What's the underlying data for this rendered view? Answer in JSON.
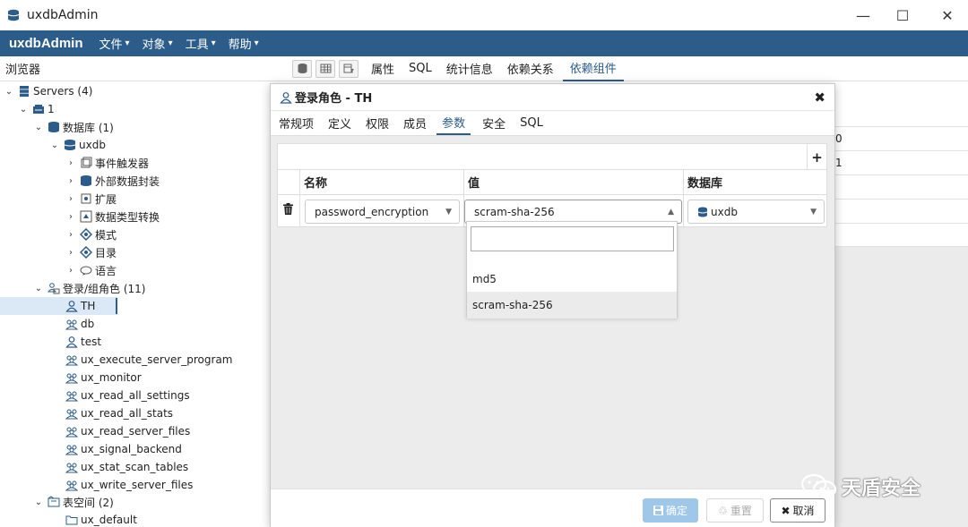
{
  "window": {
    "title": "uxdbAdmin",
    "minimize": "—",
    "maximize": "☐",
    "close": "✕"
  },
  "menubar": {
    "brand": "uxdbAdmin",
    "items": [
      {
        "label": "文件"
      },
      {
        "label": "对象"
      },
      {
        "label": "工具"
      },
      {
        "label": "帮助"
      }
    ]
  },
  "browser": {
    "title": "浏览器"
  },
  "panel_tabs": [
    {
      "label": "属性"
    },
    {
      "label": "SQL"
    },
    {
      "label": "统计信息"
    },
    {
      "label": "依赖关系"
    },
    {
      "label": "依赖组件"
    }
  ],
  "tree": {
    "servers": "Servers (4)",
    "server1": "1",
    "databases": "数据库 (1)",
    "uxdb": "uxdb",
    "event_triggers": "事件触发器",
    "fdw": "外部数据封装",
    "extensions": "扩展",
    "casts": "数据类型转换",
    "schemas": "模式",
    "catalogs": "目录",
    "languages": "语言",
    "roles": "登录/组角色 (11)",
    "role_items": [
      "TH",
      "db",
      "test",
      "ux_execute_server_program",
      "ux_monitor",
      "ux_read_all_settings",
      "ux_read_all_stats",
      "ux_read_server_files",
      "ux_signal_backend",
      "ux_stat_scan_tables",
      "ux_write_server_files"
    ],
    "tablespaces": "表空间 (2)",
    "ux_default": "ux_default"
  },
  "right_panel": {
    "values": [
      "0",
      "1"
    ]
  },
  "dialog": {
    "title": "登录角色 - TH",
    "close": "✖",
    "tabs": [
      {
        "label": "常规项"
      },
      {
        "label": "定义"
      },
      {
        "label": "权限"
      },
      {
        "label": "成员"
      },
      {
        "label": "参数"
      },
      {
        "label": "安全"
      },
      {
        "label": "SQL"
      }
    ],
    "active_tab": "参数",
    "add": "+",
    "columns": {
      "name": "名称",
      "value": "值",
      "database": "数据库"
    },
    "row": {
      "name": "password_encryption",
      "value": "scram-sha-256",
      "database": "uxdb"
    },
    "dropdown": {
      "search_value": "",
      "options": [
        "md5",
        "scram-sha-256"
      ],
      "highlighted": "scram-sha-256"
    },
    "buttons": {
      "ok": "确定",
      "reset": "重置",
      "cancel": "取消"
    }
  },
  "watermark": "天盾安全",
  "colors": {
    "accent": "#2c5c8a",
    "ok_button": "#9fc7ea"
  }
}
